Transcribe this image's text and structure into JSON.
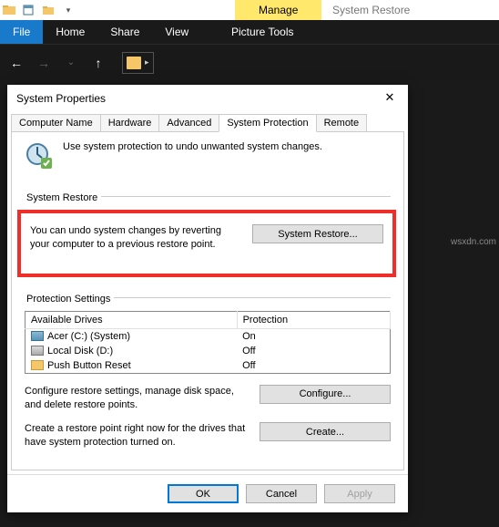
{
  "titlebar": {
    "manage": "Manage",
    "appname": "System Restore"
  },
  "ribbon": {
    "file": "File",
    "home": "Home",
    "share": "Share",
    "view": "View",
    "picture_tools": "Picture Tools"
  },
  "dialog": {
    "title": "System Properties",
    "tabs": {
      "computer_name": "Computer Name",
      "hardware": "Hardware",
      "advanced": "Advanced",
      "system_protection": "System Protection",
      "remote": "Remote"
    },
    "intro": "Use system protection to undo unwanted system changes.",
    "restore_group": "System Restore",
    "restore_desc": "You can undo system changes by reverting your computer to a previous restore point.",
    "restore_btn": "System Restore...",
    "protection_group": "Protection Settings",
    "table": {
      "col_drives": "Available Drives",
      "col_protection": "Protection",
      "rows": [
        {
          "name": "Acer (C:) (System)",
          "protection": "On",
          "icon": "hd"
        },
        {
          "name": "Local Disk (D:)",
          "protection": "Off",
          "icon": "hd2"
        },
        {
          "name": "Push Button Reset",
          "protection": "Off",
          "icon": "fd"
        }
      ]
    },
    "configure_desc": "Configure restore settings, manage disk space, and delete restore points.",
    "configure_btn": "Configure...",
    "create_desc": "Create a restore point right now for the drives that have system protection turned on.",
    "create_btn": "Create...",
    "ok": "OK",
    "cancel": "Cancel",
    "apply": "Apply"
  },
  "watermark": "wsxdn.com"
}
